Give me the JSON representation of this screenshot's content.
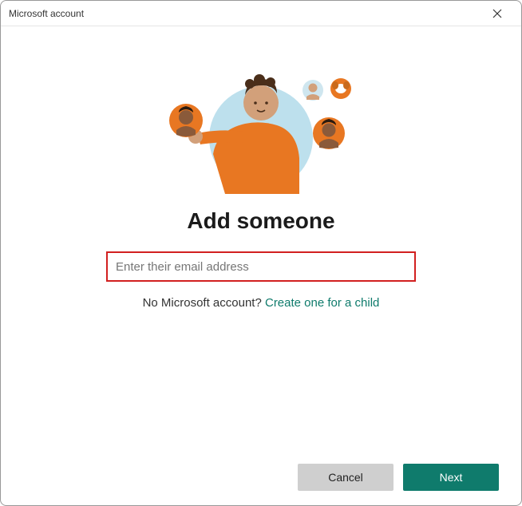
{
  "window": {
    "title": "Microsoft account"
  },
  "main": {
    "heading": "Add someone",
    "email_placeholder": "Enter their email address",
    "no_account_text": "No Microsoft account? ",
    "create_link_text": "Create one for a child"
  },
  "footer": {
    "cancel_label": "Cancel",
    "next_label": "Next"
  },
  "colors": {
    "accent": "#0f7b6c",
    "highlight_border": "#d22020",
    "orange": "#e87722",
    "skin1": "#d2a07a",
    "skin2": "#8a5a3a",
    "hair_dark": "#4a2e1a",
    "bg_circle": "#bde0ed"
  }
}
